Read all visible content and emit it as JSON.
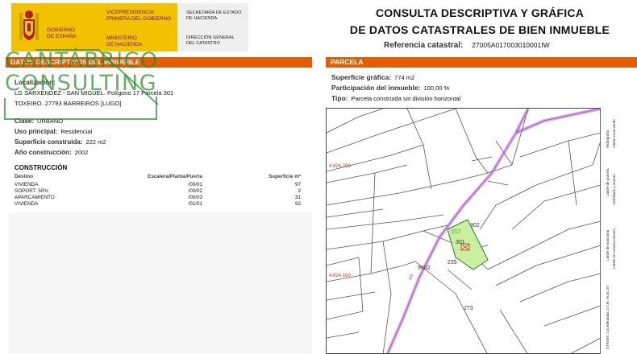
{
  "header": {
    "ministry_left": [
      "Gobierno",
      "de España"
    ],
    "ministry_mid_top": [
      "Vicepresidencia",
      "Primera del Gobierno"
    ],
    "ministry_mid_bottom": [
      "Ministerio",
      "de Hacienda"
    ],
    "right_top": [
      "Secretaría de Estado",
      "de Hacienda"
    ],
    "right_bottom": [
      "Dirección General",
      "del Catastro"
    ],
    "title_line1": "CONSULTA DESCRIPTIVA Y GRÁFICA",
    "title_line2": "DE DATOS CATASTRALES DE BIEN INMUEBLE",
    "ref_label": "Referencia catastral:",
    "ref_value": "27005A017003010001IW"
  },
  "left": {
    "section_title": "DATOS DESCRIPTIVOS DEL INMUEBLE",
    "localizacion_label": "Localización:",
    "localizacion_line1": "LG SARXENDEZ - SAN MIGUEL. Polígono 17 Parcela 301",
    "localizacion_line2": "TOXEIRO. 27793 BARREIROS [LUGO]",
    "clase_label": "Clase:",
    "clase_value": "URBANO",
    "uso_label": "Uso principal:",
    "uso_value": "Residencial",
    "superficie_label": "Superficie construida:",
    "superficie_value": "222 m2",
    "anio_label": "Año construcción:",
    "anio_value": "2002",
    "construccion_title": "CONSTRUCCIÓN",
    "table_headers": [
      "Destino",
      "Escalera/Planta/Puerta",
      "Superficie m²"
    ],
    "table_rows": [
      [
        "VIVIENDA",
        "/00/01",
        "97"
      ],
      [
        "SOPORT. 50%",
        "/00/02",
        "2"
      ],
      [
        "APARCAMIENTO",
        "/00/03",
        "31"
      ],
      [
        "VIVIENDA",
        "/01/01",
        "92"
      ]
    ]
  },
  "watermark": {
    "line1": "CANTÁBRICO",
    "line2": "CONSULTING"
  },
  "right": {
    "section_title": "PARCELA",
    "sup_label": "Superficie gráfica:",
    "sup_value": "774 m2",
    "part_label": "Participación del inmueble:",
    "part_value": "100,00 %",
    "tipo_label": "Tipo:",
    "tipo_value": "Parcela construida sin división horizontal"
  },
  "map": {
    "coord_top": "4.824.200",
    "coord_bottom": "4.824.100",
    "parcel_labels": [
      "302",
      "301",
      "235",
      "9002",
      "273",
      "017"
    ],
    "road_label": "DS",
    "colors": {
      "parcel_fill": "#c8f0a0",
      "road": "#b060d0",
      "coord": "#d03030",
      "lines": "#555555",
      "section_bar": "#e65c00"
    },
    "legend": [
      "Hidrografía",
      "Límite zona verde",
      "Límite de parcela",
      "Mobiliario y aceras",
      "Límite de manzana",
      "Límite en construcciones",
      "ETRS89: Coordenadas U.T.M. Huso 29"
    ]
  }
}
